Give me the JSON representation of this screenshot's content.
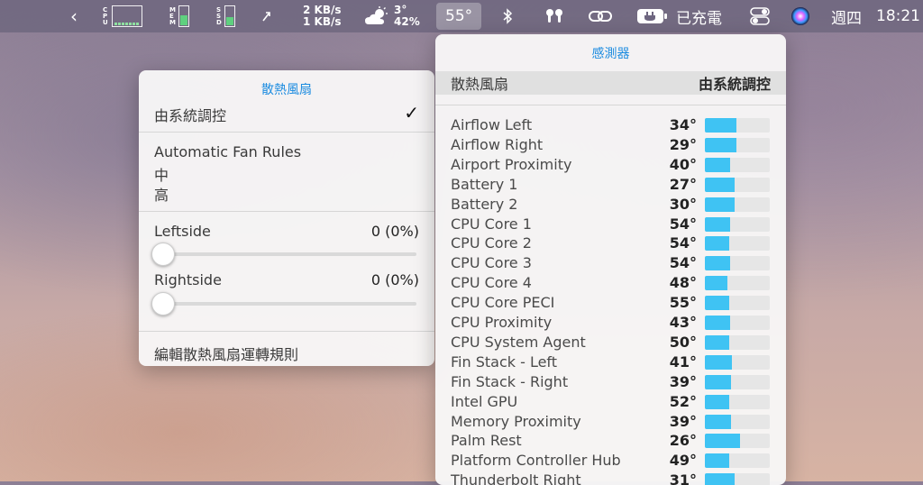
{
  "menubar": {
    "chevron": "‹",
    "cpu_label": [
      "C",
      "P",
      "U"
    ],
    "mem_label": [
      "M",
      "E",
      "M"
    ],
    "ssd_label": [
      "S",
      "S",
      "D"
    ],
    "mem_fraction": 0.55,
    "ssd_fraction": 0.45,
    "upload": "2 KB/s",
    "download": "1 KB/s",
    "weather_temp": "3°",
    "weather_humidity": "42%",
    "temp": "55°",
    "battery_text": "已充電",
    "day": "週四",
    "time": "18:21"
  },
  "fan_menu": {
    "title": "散熱風扇",
    "selected_mode": "由系統調控",
    "check": "✓",
    "rules_header": "Automatic Fan Rules",
    "rule_mid": "中",
    "rule_high": "高",
    "fans": [
      {
        "name": "Leftside",
        "value": "0 (0%)",
        "fraction": 0
      },
      {
        "name": "Rightside",
        "value": "0 (0%)",
        "fraction": 0
      }
    ],
    "edit_rules": "編輯散熱風扇運轉規則"
  },
  "sensor_menu": {
    "title": "感測器",
    "header_left": "散熱風扇",
    "header_right": "由系統調控",
    "sensors": [
      {
        "name": "Airflow Left",
        "value": "34°",
        "fraction": 0.48
      },
      {
        "name": "Airflow Right",
        "value": "29°",
        "fraction": 0.48
      },
      {
        "name": "Airport Proximity",
        "value": "40°",
        "fraction": 0.39
      },
      {
        "name": "Battery 1",
        "value": "27°",
        "fraction": 0.46
      },
      {
        "name": "Battery 2",
        "value": "30°",
        "fraction": 0.46
      },
      {
        "name": "CPU Core 1",
        "value": "54°",
        "fraction": 0.39
      },
      {
        "name": "CPU Core 2",
        "value": "54°",
        "fraction": 0.37
      },
      {
        "name": "CPU Core 3",
        "value": "54°",
        "fraction": 0.39
      },
      {
        "name": "CPU Core 4",
        "value": "48°",
        "fraction": 0.35
      },
      {
        "name": "CPU Core PECI",
        "value": "55°",
        "fraction": 0.37
      },
      {
        "name": "CPU Proximity",
        "value": "43°",
        "fraction": 0.39
      },
      {
        "name": "CPU System Agent",
        "value": "50°",
        "fraction": 0.37
      },
      {
        "name": "Fin Stack - Left",
        "value": "41°",
        "fraction": 0.42
      },
      {
        "name": "Fin Stack - Right",
        "value": "39°",
        "fraction": 0.4
      },
      {
        "name": "Intel GPU",
        "value": "52°",
        "fraction": 0.38
      },
      {
        "name": "Memory Proximity",
        "value": "39°",
        "fraction": 0.4
      },
      {
        "name": "Palm Rest",
        "value": "26°",
        "fraction": 0.54
      },
      {
        "name": "Platform Controller Hub",
        "value": "49°",
        "fraction": 0.38
      },
      {
        "name": "Thunderbolt Right",
        "value": "31°",
        "fraction": 0.46
      }
    ]
  }
}
